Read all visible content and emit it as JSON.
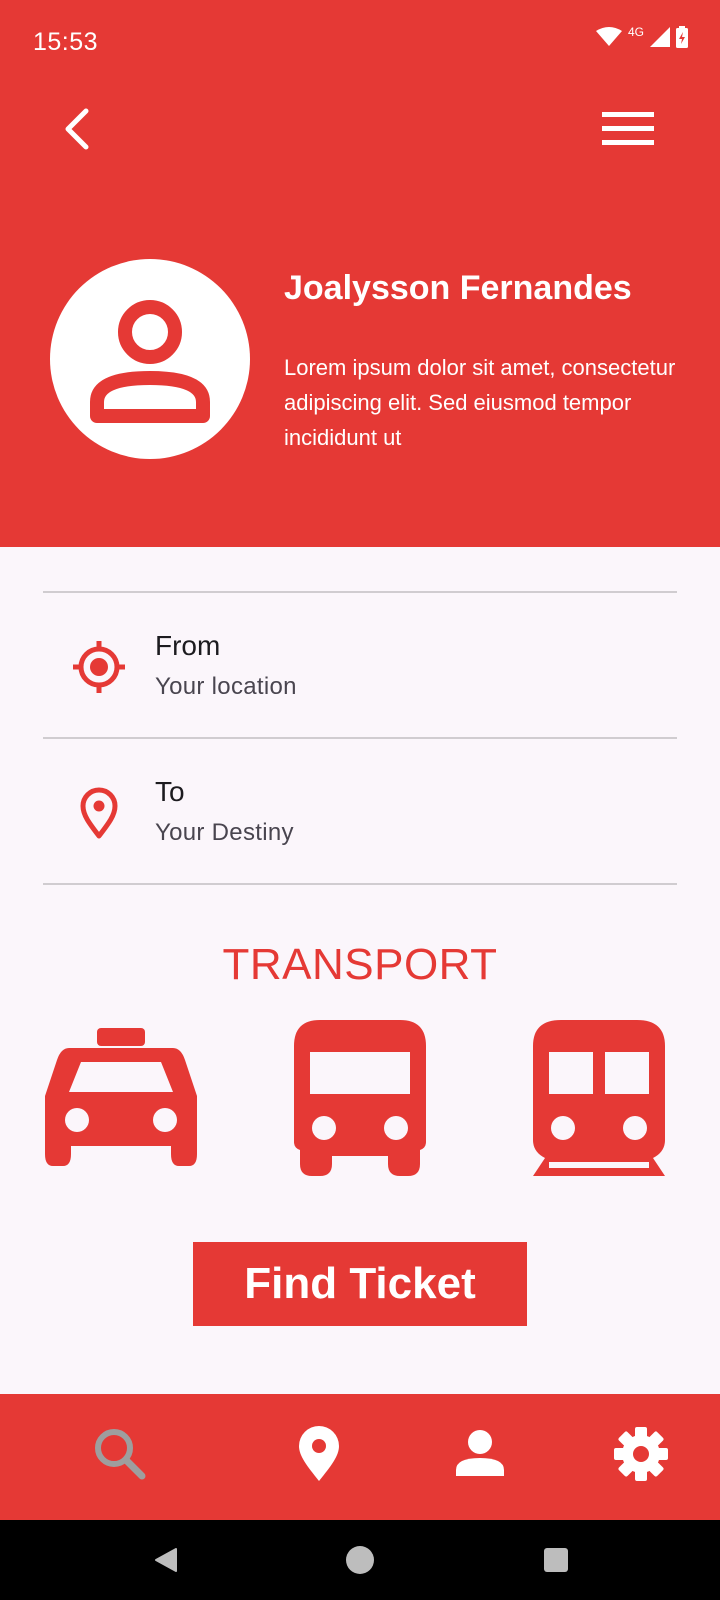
{
  "status_bar": {
    "time": "15:53",
    "network": "4G"
  },
  "profile": {
    "name": "Joalysson Fernandes",
    "description": "Lorem ipsum dolor sit amet, consectetur adipiscing elit. Sed eiusmod tempor incididunt ut"
  },
  "route": {
    "from": {
      "label": "From",
      "placeholder": "Your location",
      "icon": "gps-target-icon"
    },
    "to": {
      "label": "To",
      "placeholder": "Your Destiny",
      "icon": "location-pin-icon"
    }
  },
  "transport": {
    "title": "TRANSPORT",
    "options": [
      "taxi-icon",
      "bus-icon",
      "train-icon"
    ]
  },
  "find_button": {
    "label": "Find Ticket"
  },
  "bottom_nav": {
    "items": [
      "search-icon",
      "location-icon",
      "person-icon",
      "settings-icon"
    ],
    "active": "search-icon"
  },
  "colors": {
    "primary": "#e53935",
    "background": "#fbf6fb",
    "inactive": "#9e9e9e"
  }
}
